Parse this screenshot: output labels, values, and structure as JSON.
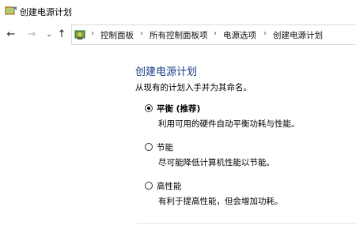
{
  "window": {
    "title": "创建电源计划",
    "icon": "power-options-icon"
  },
  "navigation": {
    "back_icon": "back-arrow-icon",
    "forward_icon": "forward-arrow-icon",
    "recent_icon": "chevron-down-icon",
    "up_icon": "up-arrow-icon",
    "breadcrumbs": [
      "控制面板",
      "所有控制面板项",
      "电源选项",
      "创建电源计划"
    ]
  },
  "main": {
    "heading": "创建电源计划",
    "subtitle": "从现有的计划入手并为其命名。",
    "plans": [
      {
        "label": "平衡 (推荐)",
        "description": "利用可用的硬件自动平衡功耗与性能。",
        "selected": true
      },
      {
        "label": "节能",
        "description": "尽可能降低计算机性能以节能。",
        "selected": false
      },
      {
        "label": "高性能",
        "description": "有利于提高性能，但会增加功耗。",
        "selected": false
      }
    ]
  },
  "colors": {
    "heading": "#1a3e8c",
    "background": "#ffffff"
  }
}
